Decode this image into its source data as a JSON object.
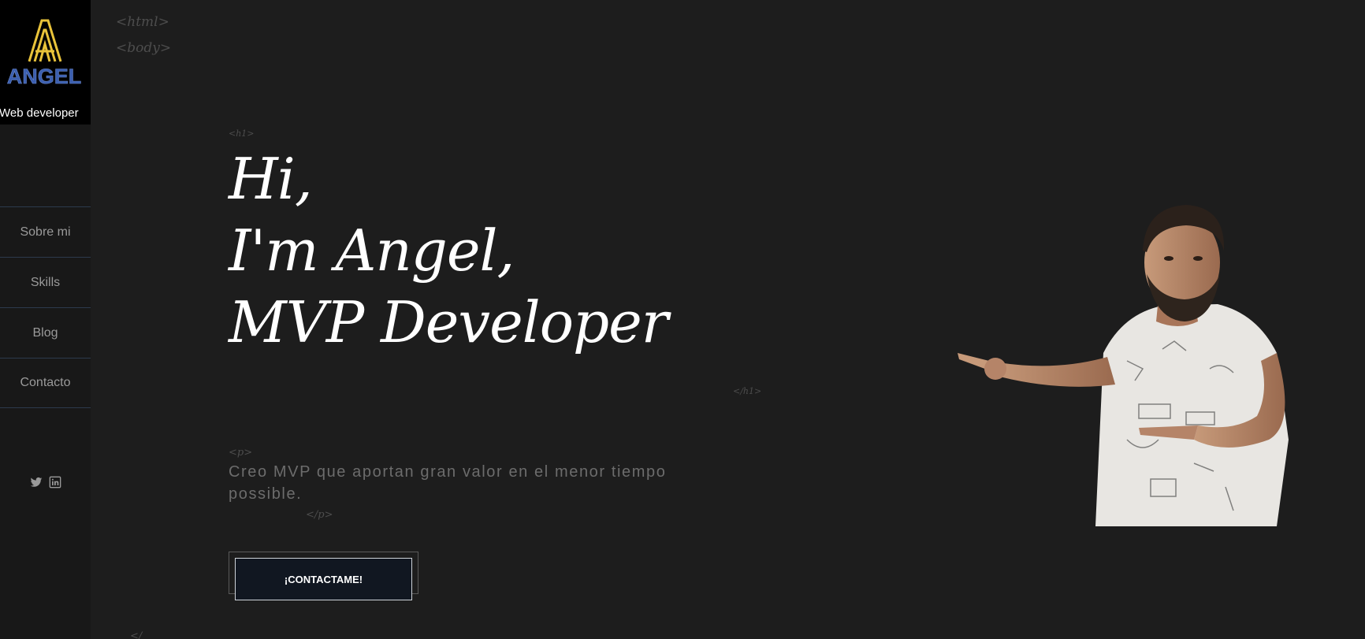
{
  "brand": {
    "logo_text": "ANGEL",
    "subtitle": "Web developer",
    "colors": {
      "logo_gold": "#e9c33a",
      "logo_blue": "#3b5fb0"
    }
  },
  "nav": {
    "items": [
      {
        "label": "Sobre mi"
      },
      {
        "label": "Skills"
      },
      {
        "label": "Blog"
      },
      {
        "label": "Contacto"
      }
    ]
  },
  "social": {
    "icons": [
      "twitter-icon",
      "linkedin-icon"
    ]
  },
  "tags": {
    "html_open": "<html>",
    "body_open": "<body>",
    "h1_open": "<h1>",
    "h1_close": "</h1>",
    "p_open": "<p>",
    "p_close": "</p>",
    "bottom": "</"
  },
  "hero": {
    "line1": "Hi,",
    "line2": "I'm Angel,",
    "line3": "MVP Developer"
  },
  "description": "Creo MVP que aportan gran valor en el menor tiempo possible.",
  "cta_label": "¡CONTACTAME!",
  "colors": {
    "background": "#1d1d1d",
    "sidebar": "#181818",
    "cta_bg": "#111721",
    "muted_text": "#6c6c6c"
  }
}
